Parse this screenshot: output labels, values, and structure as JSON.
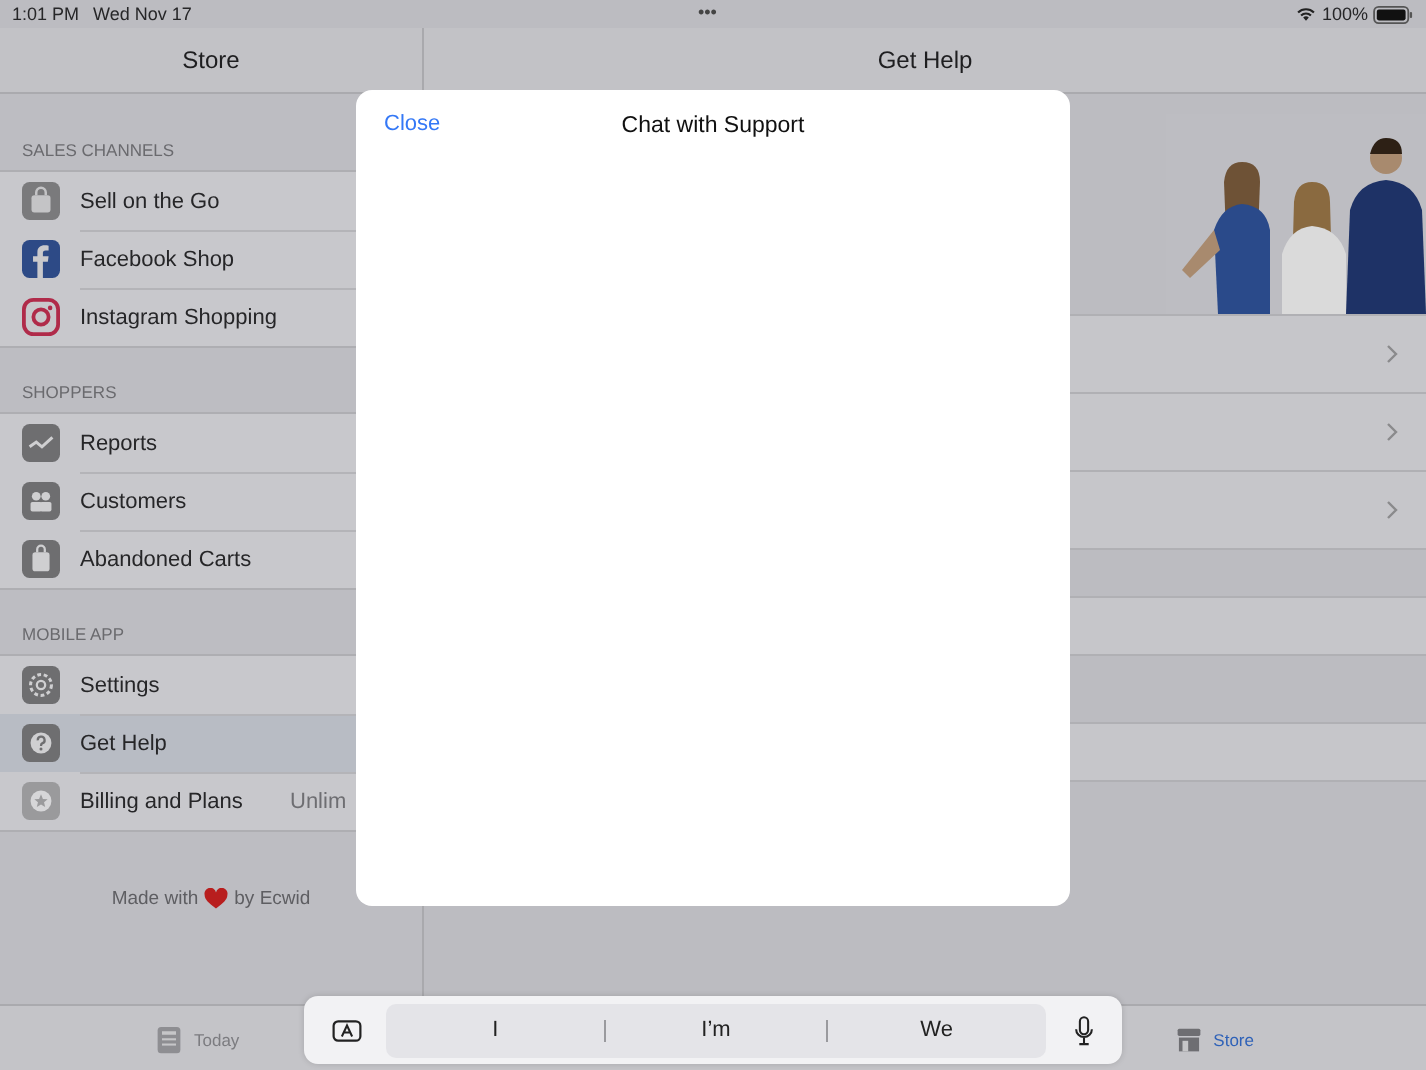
{
  "status_bar": {
    "time": "1:01 PM",
    "date": "Wed Nov 17",
    "dots": "•••",
    "battery": "100%"
  },
  "sidebar": {
    "title": "Store",
    "sections": [
      {
        "header": "SALES CHANNELS",
        "items": [
          {
            "label": "Sell on the Go",
            "selected": false
          },
          {
            "label": "Facebook Shop",
            "selected": false
          },
          {
            "label": "Instagram Shopping",
            "selected": false
          }
        ]
      },
      {
        "header": "SHOPPERS",
        "items": [
          {
            "label": "Reports",
            "selected": false
          },
          {
            "label": "Customers",
            "selected": false
          },
          {
            "label": "Abandoned Carts",
            "selected": false
          }
        ]
      },
      {
        "header": "MOBILE APP",
        "items": [
          {
            "label": "Settings",
            "selected": false
          },
          {
            "label": "Get Help",
            "selected": true
          },
          {
            "label": "Billing and Plans",
            "selected": false,
            "detail": "Unlim"
          }
        ]
      }
    ],
    "footer": {
      "before": "Made with",
      "after": "by Ecwid"
    }
  },
  "detail": {
    "title": "Get Help"
  },
  "modal": {
    "close": "Close",
    "title": "Chat with Support"
  },
  "tab_bar": [
    {
      "label": "Today",
      "selected": false
    },
    {
      "label": "Store",
      "selected": true
    }
  ],
  "keyboard_bar": {
    "suggestions": [
      "I",
      "I’m",
      "We"
    ]
  }
}
